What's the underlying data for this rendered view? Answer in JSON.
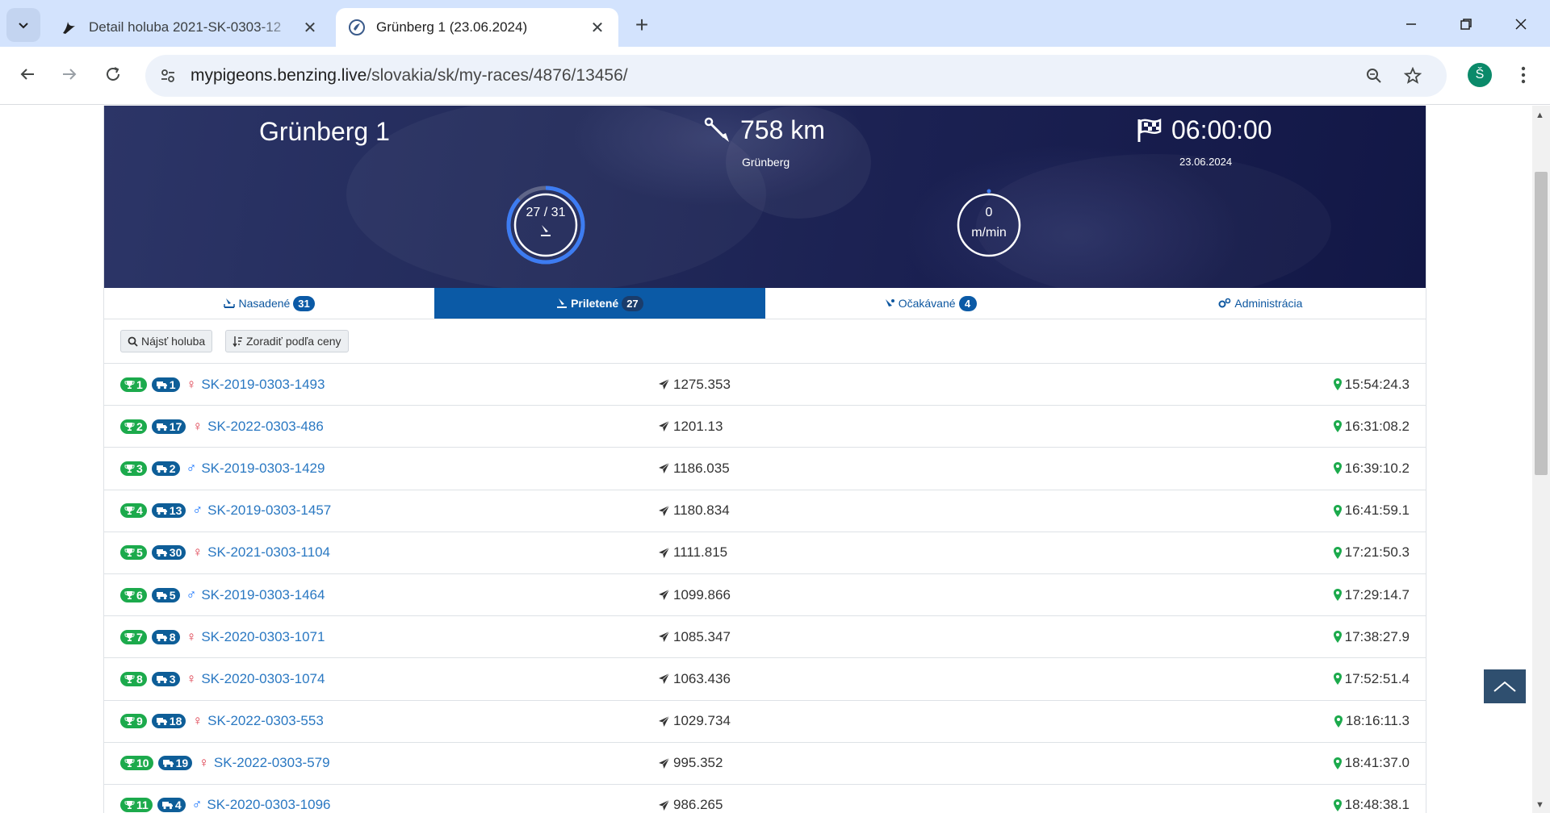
{
  "browser": {
    "tabs": [
      {
        "title": "Detail holuba 2021-SK-0303-12",
        "active": false
      },
      {
        "title": "Grünberg 1 (23.06.2024)",
        "active": true
      }
    ],
    "url_host": "mypigeons.benzing.live",
    "url_path": "/slovakia/sk/my-races/4876/13456/",
    "profile_initial": "Š"
  },
  "race": {
    "name": "Grünberg 1",
    "distance": "758 km",
    "distance_place": "Grünberg",
    "start_time": "06:00:00",
    "start_date": "23.06.2024",
    "arrived_gauge": {
      "label": "27 / 31",
      "arrived": 27,
      "total": 31
    },
    "speed_gauge": {
      "value": "0",
      "unit": "m/min"
    }
  },
  "tabs": [
    {
      "label": "Nasadené",
      "count": "31",
      "active": false
    },
    {
      "label": "Priletené",
      "count": "27",
      "active": true
    },
    {
      "label": "Očakávané",
      "count": "4",
      "active": false
    },
    {
      "label": "Administrácia",
      "count": "",
      "active": false
    }
  ],
  "buttons": {
    "find": "Nájsť holuba",
    "sort": "Zoradiť podľa ceny"
  },
  "results": [
    {
      "place": "1",
      "team": "1",
      "sex": "f",
      "ring": "SK-2019-0303-1493",
      "speed": "1275.353",
      "time": "15:54:24.3"
    },
    {
      "place": "2",
      "team": "17",
      "sex": "f",
      "ring": "SK-2022-0303-486",
      "speed": "1201.13",
      "time": "16:31:08.2"
    },
    {
      "place": "3",
      "team": "2",
      "sex": "m",
      "ring": "SK-2019-0303-1429",
      "speed": "1186.035",
      "time": "16:39:10.2"
    },
    {
      "place": "4",
      "team": "13",
      "sex": "m",
      "ring": "SK-2019-0303-1457",
      "speed": "1180.834",
      "time": "16:41:59.1"
    },
    {
      "place": "5",
      "team": "30",
      "sex": "f",
      "ring": "SK-2021-0303-1104",
      "speed": "1111.815",
      "time": "17:21:50.3"
    },
    {
      "place": "6",
      "team": "5",
      "sex": "m",
      "ring": "SK-2019-0303-1464",
      "speed": "1099.866",
      "time": "17:29:14.7"
    },
    {
      "place": "7",
      "team": "8",
      "sex": "f",
      "ring": "SK-2020-0303-1071",
      "speed": "1085.347",
      "time": "17:38:27.9"
    },
    {
      "place": "8",
      "team": "3",
      "sex": "f",
      "ring": "SK-2020-0303-1074",
      "speed": "1063.436",
      "time": "17:52:51.4"
    },
    {
      "place": "9",
      "team": "18",
      "sex": "f",
      "ring": "SK-2022-0303-553",
      "speed": "1029.734",
      "time": "18:16:11.3"
    },
    {
      "place": "10",
      "team": "19",
      "sex": "f",
      "ring": "SK-2022-0303-579",
      "speed": "995.352",
      "time": "18:41:37.0"
    },
    {
      "place": "11",
      "team": "4",
      "sex": "m",
      "ring": "SK-2020-0303-1096",
      "speed": "986.265",
      "time": "18:48:38.1"
    }
  ],
  "colors": {
    "place_badge": "#1caa4c",
    "team_badge": "#0e5e98",
    "link": "#2a78c2",
    "active_tab": "#0b5aa6",
    "female": "#dc3545",
    "male": "#0d6efd"
  }
}
